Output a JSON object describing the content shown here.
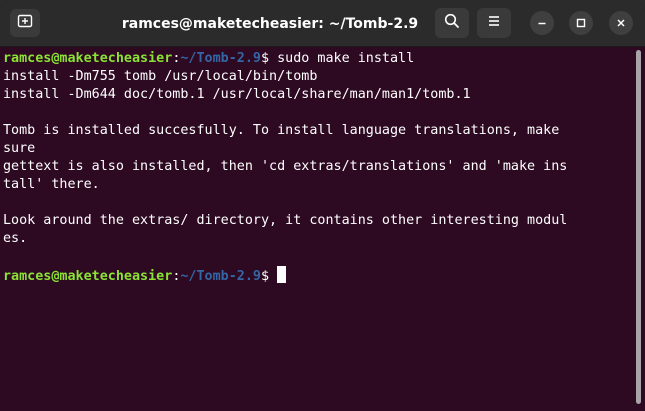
{
  "window": {
    "title": "ramces@maketecheasier: ~/Tomb-2.9"
  },
  "titlebar": {
    "icons": {
      "new_tab": "new-tab-icon",
      "search": "search-icon",
      "menu": "hamburger-menu-icon",
      "minimize": "minimize-icon",
      "maximize": "maximize-icon",
      "close": "close-icon"
    }
  },
  "terminal": {
    "prompt": {
      "user_host": "ramces@maketecheasier",
      "colon": ":",
      "path": "~/Tomb-2.9",
      "symbol": "$"
    },
    "command": " sudo make install",
    "lines": [
      "install -Dm755 tomb /usr/local/bin/tomb",
      "install -Dm644 doc/tomb.1 /usr/local/share/man/man1/tomb.1",
      "",
      "Tomb is installed succesfully. To install language translations, make",
      "sure",
      "gettext is also installed, then 'cd extras/translations' and 'make ins",
      "tall' there.",
      "",
      "Look around the extras/ directory, it contains other interesting modul",
      "es.",
      ""
    ],
    "final_prompt_suffix": " "
  },
  "colors": {
    "background": "#2d0922",
    "prompt_user": "#8ae234",
    "prompt_path": "#3465a4",
    "text": "#ffffff",
    "titlebar": "#2b2b2b"
  }
}
